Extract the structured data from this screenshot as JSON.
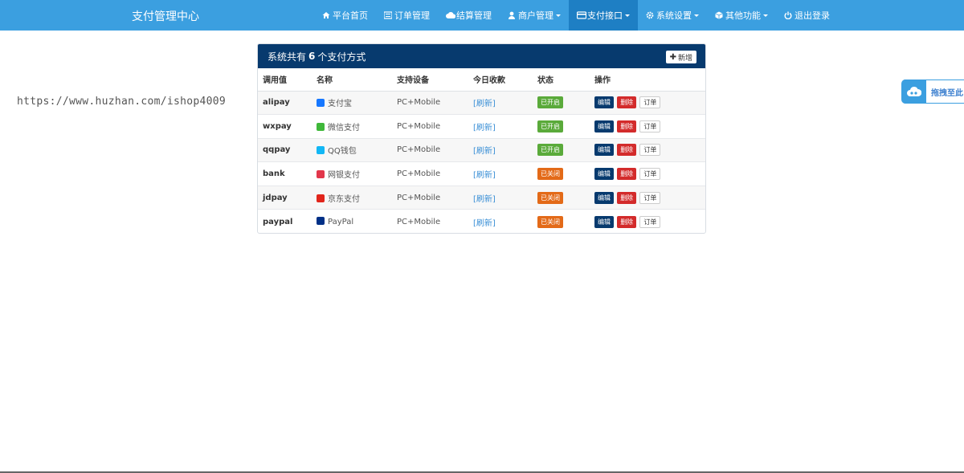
{
  "brand": "支付管理中心",
  "nav": [
    {
      "label": "平台首页",
      "icon": "home-icon",
      "caret": false,
      "active": false
    },
    {
      "label": "订单管理",
      "icon": "list-icon",
      "caret": false,
      "active": false
    },
    {
      "label": "结算管理",
      "icon": "cloud-icon",
      "caret": false,
      "active": false
    },
    {
      "label": "商户管理",
      "icon": "user-icon",
      "caret": true,
      "active": false
    },
    {
      "label": "支付接口",
      "icon": "credit-card-icon",
      "caret": true,
      "active": true
    },
    {
      "label": "系统设置",
      "icon": "gear-icon",
      "caret": true,
      "active": false
    },
    {
      "label": "其他功能",
      "icon": "cube-icon",
      "caret": true,
      "active": false
    },
    {
      "label": "退出登录",
      "icon": "power-icon",
      "caret": false,
      "active": false
    }
  ],
  "watermark": "https://www.huzhan.com/ishop4009",
  "side_tab": {
    "label": "拖拽至此",
    "icon": "cloud-upload-icon"
  },
  "panel": {
    "title_prefix": "系统共有",
    "title_count": "6",
    "title_suffix": "个支付方式",
    "add_label": "新增"
  },
  "table": {
    "headers": [
      "调用值",
      "名称",
      "支持设备",
      "今日收款",
      "状态",
      "操作"
    ],
    "rows": [
      {
        "code": "alipay",
        "name": "支付宝",
        "icon": "alipay-icon",
        "icon_color": "#1677ff",
        "device": "PC+Mobile",
        "today": "[刷新]",
        "status": "已开启",
        "enabled": true
      },
      {
        "code": "wxpay",
        "name": "微信支付",
        "icon": "wechat-pay-icon",
        "icon_color": "#3fb83a",
        "device": "PC+Mobile",
        "today": "[刷新]",
        "status": "已开启",
        "enabled": true
      },
      {
        "code": "qqpay",
        "name": "QQ钱包",
        "icon": "qq-wallet-icon",
        "icon_color": "#12b7f5",
        "device": "PC+Mobile",
        "today": "[刷新]",
        "status": "已开启",
        "enabled": true
      },
      {
        "code": "bank",
        "name": "网银支付",
        "icon": "unionpay-icon",
        "icon_color": "#e2374b",
        "device": "PC+Mobile",
        "today": "[刷新]",
        "status": "已关闭",
        "enabled": false
      },
      {
        "code": "jdpay",
        "name": "京东支付",
        "icon": "jd-pay-icon",
        "icon_color": "#e1251b",
        "device": "PC+Mobile",
        "today": "[刷新]",
        "status": "已关闭",
        "enabled": false
      },
      {
        "code": "paypal",
        "name": "PayPal",
        "icon": "paypal-icon",
        "icon_color": "#003087",
        "device": "PC+Mobile",
        "today": "[刷新]",
        "status": "已关闭",
        "enabled": false
      }
    ],
    "actions": {
      "edit": "编辑",
      "delete": "删除",
      "orders": "订单"
    }
  },
  "colors": {
    "navbar": "#3b9fe0",
    "panel_header": "#073a6e",
    "enabled": "#5aaa3a",
    "disabled": "#e36a18",
    "delete": "#d32b2b"
  }
}
